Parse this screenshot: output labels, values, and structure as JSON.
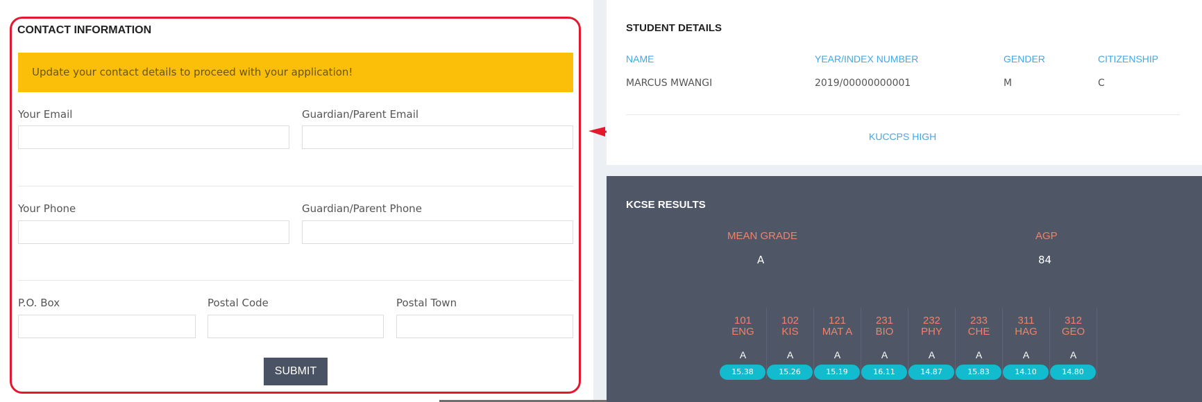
{
  "contact": {
    "title": "CONTACT INFORMATION",
    "alert": "Update your contact details to proceed with your application!",
    "fields": {
      "your_email": {
        "label": "Your Email",
        "value": ""
      },
      "guardian_email": {
        "label": "Guardian/Parent Email",
        "value": ""
      },
      "your_phone": {
        "label": "Your Phone",
        "value": ""
      },
      "guardian_phone": {
        "label": "Guardian/Parent Phone",
        "value": ""
      },
      "po_box": {
        "label": "P.O. Box",
        "value": ""
      },
      "postal_code": {
        "label": "Postal Code",
        "value": ""
      },
      "postal_town": {
        "label": "Postal Town",
        "value": ""
      }
    },
    "submit_label": "SUBMIT"
  },
  "student": {
    "title": "STUDENT DETAILS",
    "headers": {
      "name": "NAME",
      "index": "YEAR/INDEX NUMBER",
      "gender": "GENDER",
      "citizenship": "CITIZENSHIP"
    },
    "values": {
      "name": "MARCUS MWANGI",
      "index": "2019/00000000001",
      "gender": "M",
      "citizenship": "C"
    },
    "school": "KUCCPS HIGH"
  },
  "results": {
    "title": "KCSE RESULTS",
    "mean_grade_label": "MEAN GRADE",
    "mean_grade": "A",
    "agp_label": "AGP",
    "agp": "84",
    "subjects": [
      {
        "code": "101",
        "name": "ENG",
        "grade": "A",
        "score": "15.38"
      },
      {
        "code": "102",
        "name": "KIS",
        "grade": "A",
        "score": "15.26"
      },
      {
        "code": "121",
        "name": "MAT A",
        "grade": "A",
        "score": "15.19"
      },
      {
        "code": "231",
        "name": "BIO",
        "grade": "A",
        "score": "16.11"
      },
      {
        "code": "232",
        "name": "PHY",
        "grade": "A",
        "score": "14.87"
      },
      {
        "code": "233",
        "name": "CHE",
        "grade": "A",
        "score": "15.83"
      },
      {
        "code": "311",
        "name": "HAG",
        "grade": "A",
        "score": "14.10"
      },
      {
        "code": "312",
        "name": "GEO",
        "grade": "A",
        "score": "14.80"
      }
    ]
  },
  "colors": {
    "highlight_border": "#e3182c",
    "alert_bg": "#fbbf0a",
    "link_blue": "#3fa9e6",
    "results_bg": "#4f5767",
    "subject_label": "#f2816b",
    "score_pill": "#12bbcd",
    "submit_bg": "#4a5363"
  }
}
